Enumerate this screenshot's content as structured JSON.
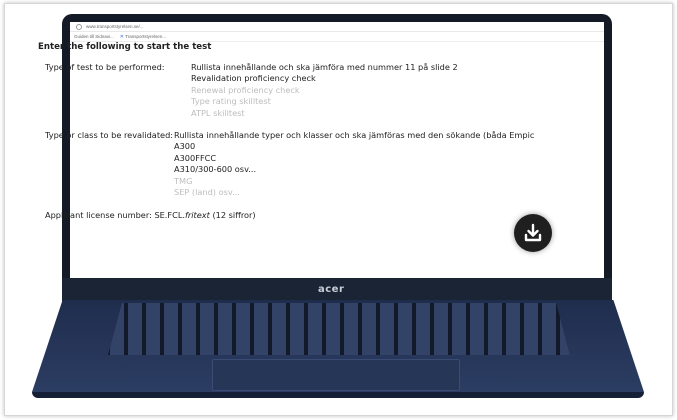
{
  "browser": {
    "url": "www.transportstyrelsen.se/...",
    "bookmarks": [
      "Guiden till Sidnavi...",
      "Transportstyrelsen..."
    ]
  },
  "content": {
    "heading": "Enter the following to start the test",
    "type_of_test": {
      "label": "Type of test to be performed:",
      "instruction": "Rullista innehållande och ska jämföra med nummer 11 på slide 2",
      "selected": "Revalidation proficiency check",
      "options": [
        "Renewal proficiency check",
        "Type rating skilltest",
        "ATPL skilltest"
      ]
    },
    "type_or_class": {
      "label": "Type or class to be revalidated:",
      "instruction": "Rullista innehållande typer och klasser och ska jämföras med den sökande (båda Empic",
      "selected": [
        "A300",
        "A300FFCC",
        "A310/300-600 osv..."
      ],
      "options": [
        "TMG",
        "SEP (land) osv..."
      ]
    },
    "license": {
      "label": "Applicant license number:",
      "prefix": "SE.FCL.",
      "value": "fritext",
      "suffix": " (12 siffror)"
    }
  },
  "laptop": {
    "brand": "acer"
  },
  "icons": {
    "download": "download-icon"
  }
}
